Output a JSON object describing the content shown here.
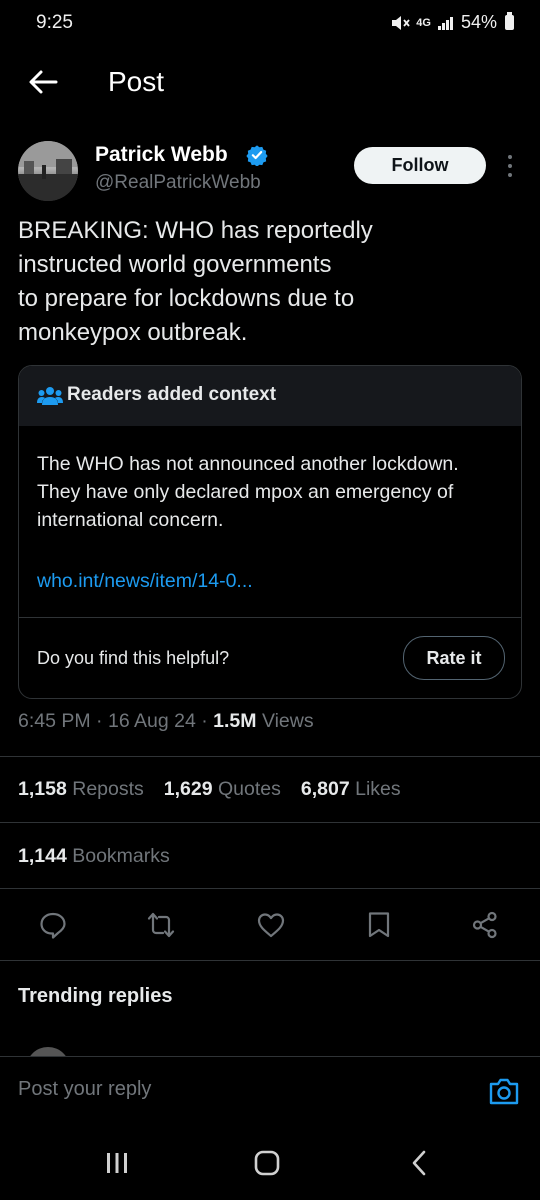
{
  "status_bar": {
    "time": "9:25",
    "network": "4G",
    "battery": "54%"
  },
  "header": {
    "title": "Post"
  },
  "author": {
    "name": "Patrick Webb",
    "handle": "@RealPatrickWebb",
    "follow_label": "Follow"
  },
  "tweet": {
    "text": "BREAKING: WHO has reportedly\ninstructed world governments\nto prepare for lockdowns due to\nmonkeypox outbreak."
  },
  "context": {
    "title": "Readers added context",
    "body": "The WHO has not announced another lockdown. They have only declared mpox an emergency of international concern.",
    "link": "who.int/news/item/14-0...",
    "helpful_prompt": "Do you find this helpful?",
    "rate_label": "Rate it"
  },
  "meta": {
    "time": "6:45 PM",
    "date": "16 Aug 24",
    "views_count": "1.5M",
    "views_label": "Views",
    "sep": "·"
  },
  "stats": {
    "reposts_count": "1,158",
    "reposts_label": "Reposts",
    "quotes_count": "1,629",
    "quotes_label": "Quotes",
    "likes_count": "6,807",
    "likes_label": "Likes",
    "bookmarks_count": "1,144",
    "bookmarks_label": "Bookmarks"
  },
  "trending": {
    "title": "Trending replies"
  },
  "reply": {
    "placeholder": "Post your reply"
  },
  "colors": {
    "accent": "#1d9bf0",
    "background": "#000000",
    "muted": "#71767b",
    "border": "#2f3336"
  },
  "icons": [
    "back-arrow-icon",
    "verified-badge-icon",
    "more-options-icon",
    "people-icon",
    "reply-icon",
    "repost-icon",
    "like-icon",
    "bookmark-icon",
    "share-icon",
    "camera-icon",
    "recent-apps-icon",
    "home-icon",
    "nav-back-icon"
  ]
}
